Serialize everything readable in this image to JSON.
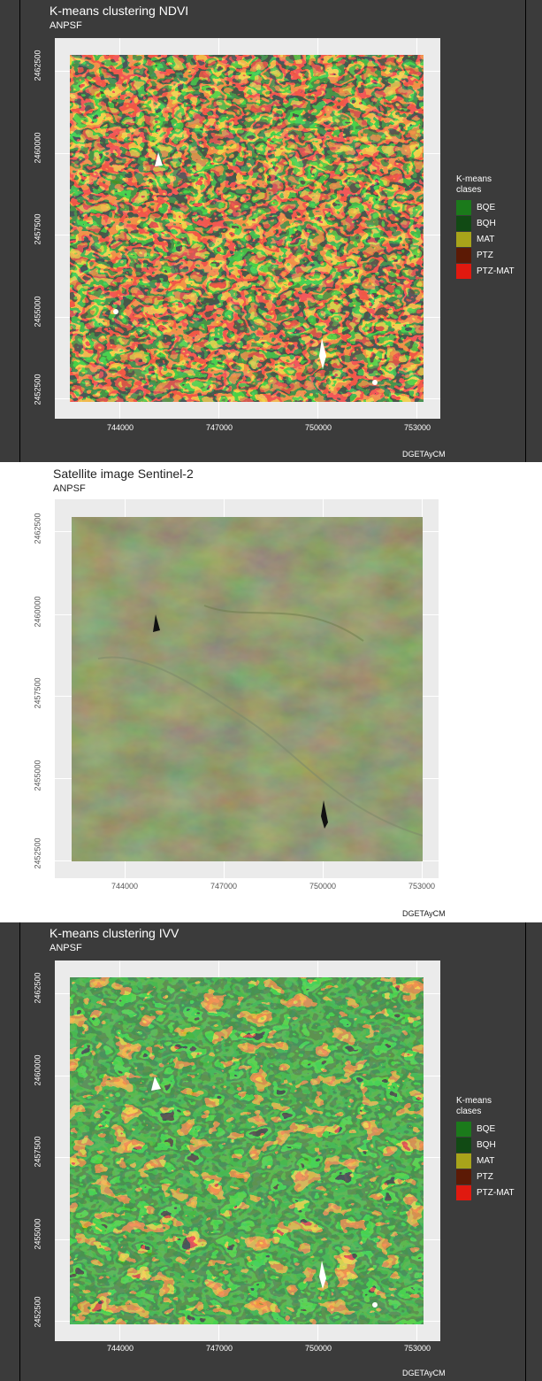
{
  "ndvi": {
    "title": "K-means clustering NDVI",
    "subtitle": "ANPSF",
    "caption": "DGETAyCM",
    "y_ticks": [
      "2462500",
      "2460000",
      "2457500",
      "2455000",
      "2452500"
    ],
    "x_ticks": [
      "744000",
      "747000",
      "750000",
      "753000"
    ],
    "legend_title": "K-means\nclases",
    "legend": [
      {
        "label": "BQE",
        "color": "#1b7a1b"
      },
      {
        "label": "BQH",
        "color": "#114a14"
      },
      {
        "label": "MAT",
        "color": "#a8a41a"
      },
      {
        "label": "PTZ",
        "color": "#5c1a05"
      },
      {
        "label": "PTZ-MAT",
        "color": "#e0190f"
      }
    ]
  },
  "satellite": {
    "title": "Satellite image Sentinel-2",
    "subtitle": "ANPSF",
    "caption": "DGETAyCM",
    "y_ticks": [
      "2462500",
      "2460000",
      "2457500",
      "2455000",
      "2452500"
    ],
    "x_ticks": [
      "744000",
      "747000",
      "750000",
      "753000"
    ]
  },
  "ivv": {
    "title": "K-means clustering IVV",
    "subtitle": "ANPSF",
    "caption": "DGETAyCM",
    "y_ticks": [
      "2462500",
      "2460000",
      "2457500",
      "2455000",
      "2452500"
    ],
    "x_ticks": [
      "744000",
      "747000",
      "750000",
      "753000"
    ],
    "legend_title": "K-means\nclases",
    "legend": [
      {
        "label": "BQE",
        "color": "#1b7a1b"
      },
      {
        "label": "BQH",
        "color": "#114a14"
      },
      {
        "label": "MAT",
        "color": "#a8a41a"
      },
      {
        "label": "PTZ",
        "color": "#5c1a05"
      },
      {
        "label": "PTZ-MAT",
        "color": "#e0190f"
      }
    ]
  }
}
